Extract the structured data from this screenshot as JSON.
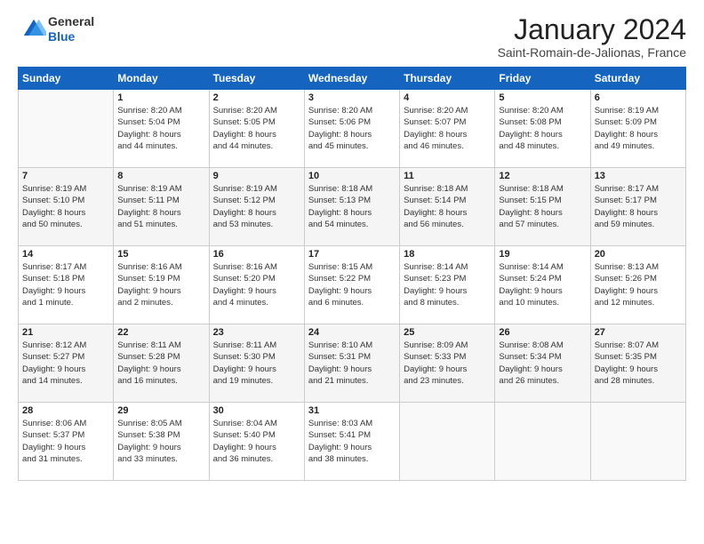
{
  "header": {
    "logo_general": "General",
    "logo_blue": "Blue",
    "title": "January 2024",
    "subtitle": "Saint-Romain-de-Jalionas, France"
  },
  "days_of_week": [
    "Sunday",
    "Monday",
    "Tuesday",
    "Wednesday",
    "Thursday",
    "Friday",
    "Saturday"
  ],
  "weeks": [
    [
      {
        "num": "",
        "info": ""
      },
      {
        "num": "1",
        "info": "Sunrise: 8:20 AM\nSunset: 5:04 PM\nDaylight: 8 hours\nand 44 minutes."
      },
      {
        "num": "2",
        "info": "Sunrise: 8:20 AM\nSunset: 5:05 PM\nDaylight: 8 hours\nand 44 minutes."
      },
      {
        "num": "3",
        "info": "Sunrise: 8:20 AM\nSunset: 5:06 PM\nDaylight: 8 hours\nand 45 minutes."
      },
      {
        "num": "4",
        "info": "Sunrise: 8:20 AM\nSunset: 5:07 PM\nDaylight: 8 hours\nand 46 minutes."
      },
      {
        "num": "5",
        "info": "Sunrise: 8:20 AM\nSunset: 5:08 PM\nDaylight: 8 hours\nand 48 minutes."
      },
      {
        "num": "6",
        "info": "Sunrise: 8:19 AM\nSunset: 5:09 PM\nDaylight: 8 hours\nand 49 minutes."
      }
    ],
    [
      {
        "num": "7",
        "info": "Sunrise: 8:19 AM\nSunset: 5:10 PM\nDaylight: 8 hours\nand 50 minutes."
      },
      {
        "num": "8",
        "info": "Sunrise: 8:19 AM\nSunset: 5:11 PM\nDaylight: 8 hours\nand 51 minutes."
      },
      {
        "num": "9",
        "info": "Sunrise: 8:19 AM\nSunset: 5:12 PM\nDaylight: 8 hours\nand 53 minutes."
      },
      {
        "num": "10",
        "info": "Sunrise: 8:18 AM\nSunset: 5:13 PM\nDaylight: 8 hours\nand 54 minutes."
      },
      {
        "num": "11",
        "info": "Sunrise: 8:18 AM\nSunset: 5:14 PM\nDaylight: 8 hours\nand 56 minutes."
      },
      {
        "num": "12",
        "info": "Sunrise: 8:18 AM\nSunset: 5:15 PM\nDaylight: 8 hours\nand 57 minutes."
      },
      {
        "num": "13",
        "info": "Sunrise: 8:17 AM\nSunset: 5:17 PM\nDaylight: 8 hours\nand 59 minutes."
      }
    ],
    [
      {
        "num": "14",
        "info": "Sunrise: 8:17 AM\nSunset: 5:18 PM\nDaylight: 9 hours\nand 1 minute."
      },
      {
        "num": "15",
        "info": "Sunrise: 8:16 AM\nSunset: 5:19 PM\nDaylight: 9 hours\nand 2 minutes."
      },
      {
        "num": "16",
        "info": "Sunrise: 8:16 AM\nSunset: 5:20 PM\nDaylight: 9 hours\nand 4 minutes."
      },
      {
        "num": "17",
        "info": "Sunrise: 8:15 AM\nSunset: 5:22 PM\nDaylight: 9 hours\nand 6 minutes."
      },
      {
        "num": "18",
        "info": "Sunrise: 8:14 AM\nSunset: 5:23 PM\nDaylight: 9 hours\nand 8 minutes."
      },
      {
        "num": "19",
        "info": "Sunrise: 8:14 AM\nSunset: 5:24 PM\nDaylight: 9 hours\nand 10 minutes."
      },
      {
        "num": "20",
        "info": "Sunrise: 8:13 AM\nSunset: 5:26 PM\nDaylight: 9 hours\nand 12 minutes."
      }
    ],
    [
      {
        "num": "21",
        "info": "Sunrise: 8:12 AM\nSunset: 5:27 PM\nDaylight: 9 hours\nand 14 minutes."
      },
      {
        "num": "22",
        "info": "Sunrise: 8:11 AM\nSunset: 5:28 PM\nDaylight: 9 hours\nand 16 minutes."
      },
      {
        "num": "23",
        "info": "Sunrise: 8:11 AM\nSunset: 5:30 PM\nDaylight: 9 hours\nand 19 minutes."
      },
      {
        "num": "24",
        "info": "Sunrise: 8:10 AM\nSunset: 5:31 PM\nDaylight: 9 hours\nand 21 minutes."
      },
      {
        "num": "25",
        "info": "Sunrise: 8:09 AM\nSunset: 5:33 PM\nDaylight: 9 hours\nand 23 minutes."
      },
      {
        "num": "26",
        "info": "Sunrise: 8:08 AM\nSunset: 5:34 PM\nDaylight: 9 hours\nand 26 minutes."
      },
      {
        "num": "27",
        "info": "Sunrise: 8:07 AM\nSunset: 5:35 PM\nDaylight: 9 hours\nand 28 minutes."
      }
    ],
    [
      {
        "num": "28",
        "info": "Sunrise: 8:06 AM\nSunset: 5:37 PM\nDaylight: 9 hours\nand 31 minutes."
      },
      {
        "num": "29",
        "info": "Sunrise: 8:05 AM\nSunset: 5:38 PM\nDaylight: 9 hours\nand 33 minutes."
      },
      {
        "num": "30",
        "info": "Sunrise: 8:04 AM\nSunset: 5:40 PM\nDaylight: 9 hours\nand 36 minutes."
      },
      {
        "num": "31",
        "info": "Sunrise: 8:03 AM\nSunset: 5:41 PM\nDaylight: 9 hours\nand 38 minutes."
      },
      {
        "num": "",
        "info": ""
      },
      {
        "num": "",
        "info": ""
      },
      {
        "num": "",
        "info": ""
      }
    ]
  ]
}
